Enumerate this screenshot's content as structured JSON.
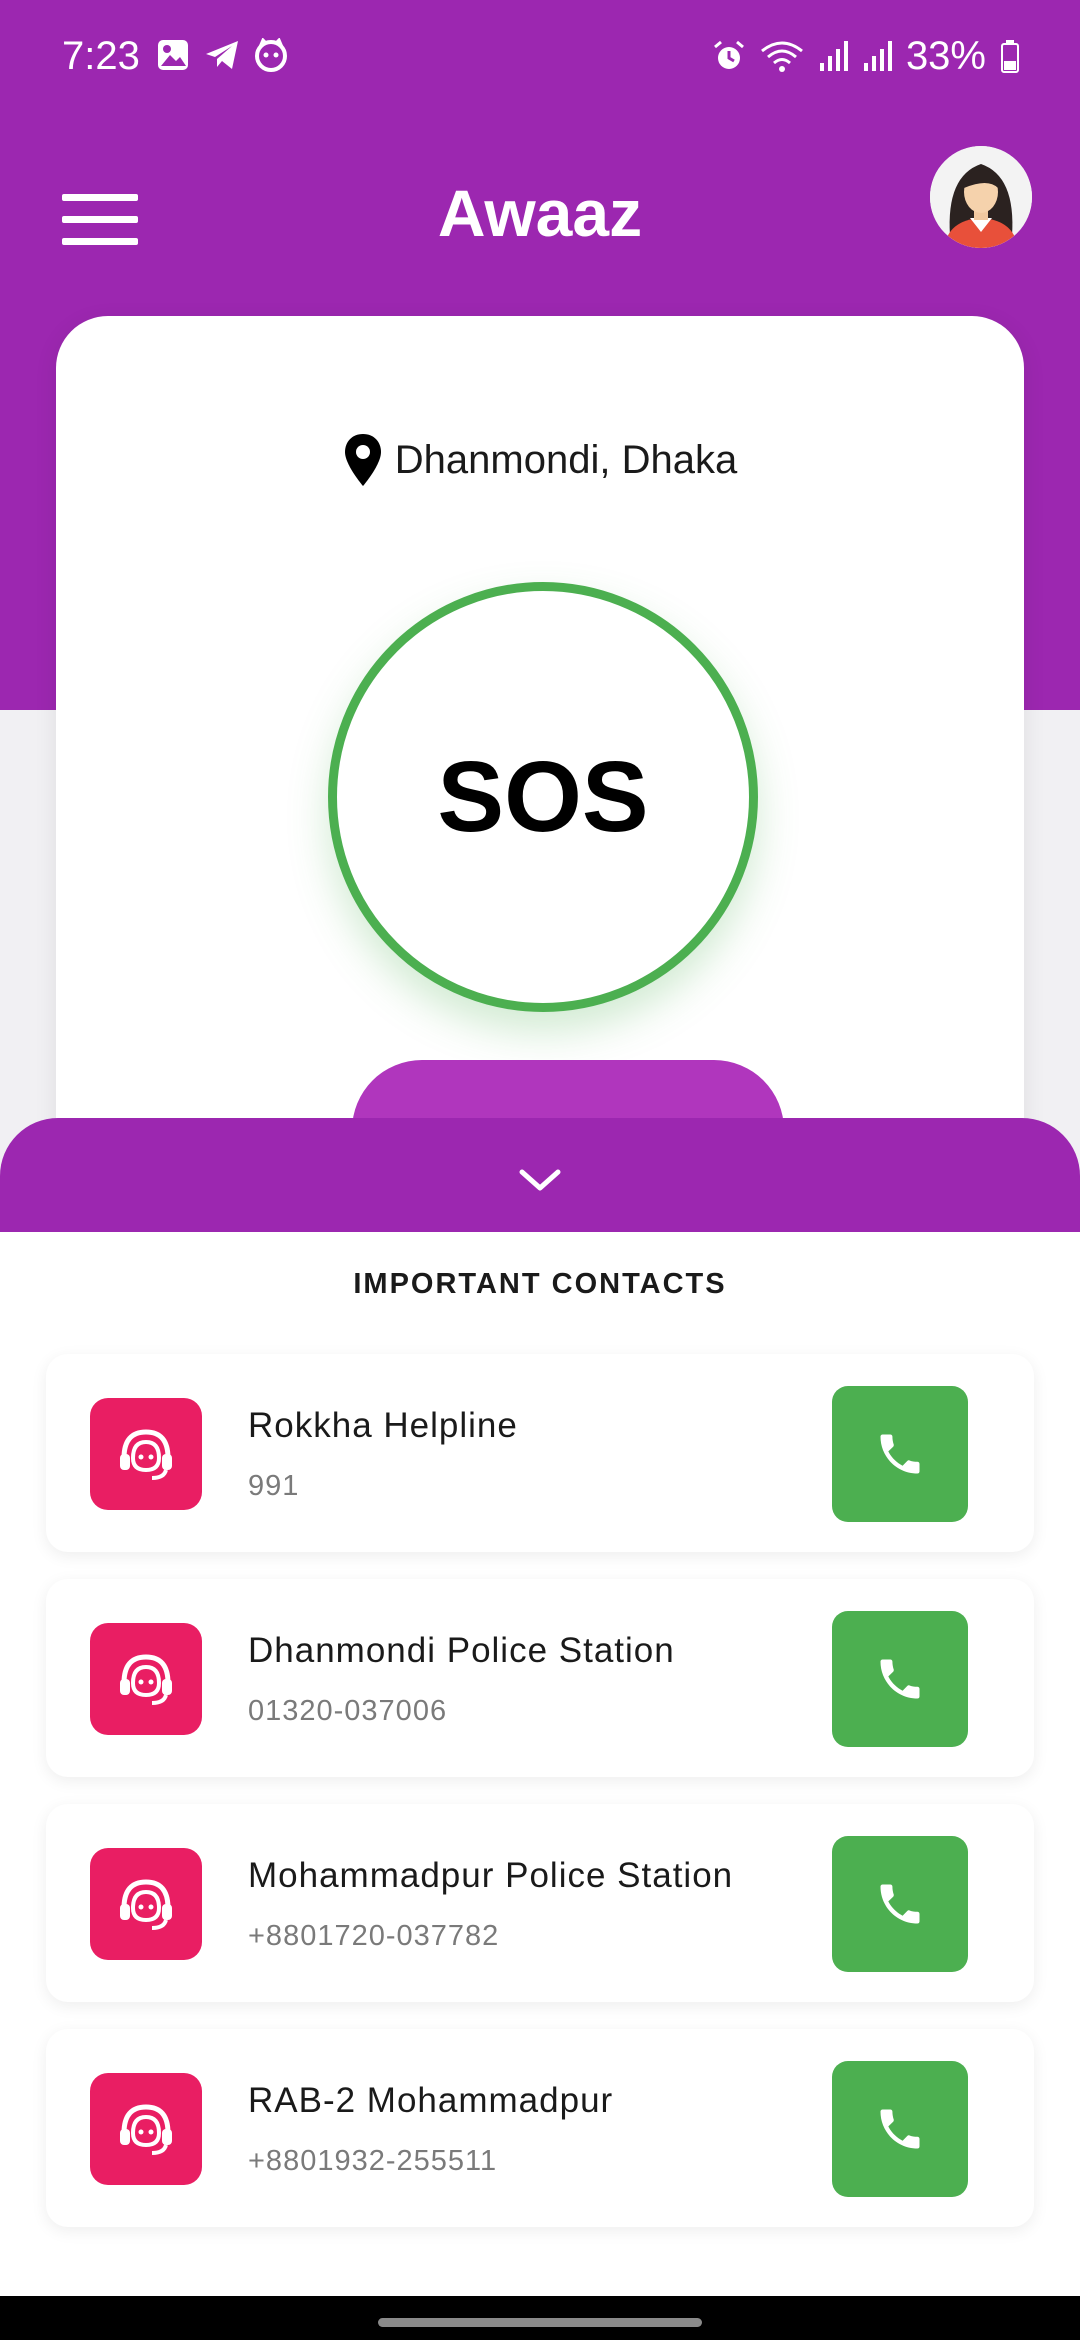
{
  "status_bar": {
    "time": "7:23",
    "battery": "33%",
    "left_icons": [
      "gallery-icon",
      "telegram-icon",
      "cat-icon"
    ],
    "right_icons": [
      "alarm-icon",
      "wifi-icon",
      "signal-icon",
      "signal-icon",
      "battery-icon"
    ]
  },
  "app_bar": {
    "title": "Awaaz"
  },
  "main_card": {
    "location": "Dhanmondi, Dhaka",
    "sos_label": "SOS"
  },
  "contacts_section": {
    "title": "IMPORTANT CONTACTS",
    "contacts": [
      {
        "name": "Rokkha Helpline",
        "number": "991"
      },
      {
        "name": "Dhanmondi Police Station",
        "number": "01320-037006"
      },
      {
        "name": "Mohammadpur Police Station",
        "number": "+8801720-037782"
      },
      {
        "name": "RAB-2 Mohammadpur",
        "number": "+8801932-255511"
      }
    ]
  },
  "colors": {
    "primary": "#9c27b0",
    "sos_ring": "#4caf50",
    "contact_icon": "#e91e63",
    "call_button": "#4caf50"
  }
}
